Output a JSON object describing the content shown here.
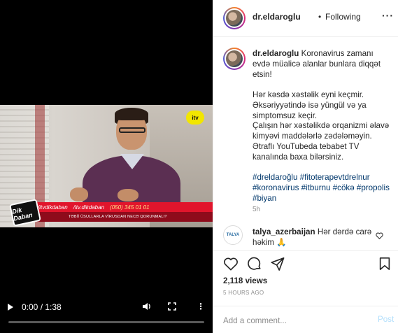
{
  "video": {
    "channel_logo": "itv",
    "show_badge": "Dik Daban",
    "lower_bar": {
      "facebook": "/itvdikdaban",
      "instagram": "/itv.dikdaban",
      "whatsapp": "(050) 345 01 01"
    },
    "lower_sub": "TƏBİİ ÜSULLARLA VİRUSDAN NECƏ QORUNMALI?",
    "time": "0:00 / 1:38",
    "progress_fraction": 0.0
  },
  "header": {
    "username": "dr.eldaroglu",
    "dot": "•",
    "follow_status": "Following",
    "menu_icon": "ellipsis-icon"
  },
  "caption": {
    "username": "dr.eldaroglu",
    "line1": "Koronavirus zamanı evdə müalicə alanlar bunlara diqqət etsin!",
    "para2": "Hər kəsdə xəstəlik eyni keçmir. Əksəriyyətində isə yüngül və ya simptomsuz keçir.",
    "para3": "Çalışın hər xəstəlikdə orqanizmi əlavə kimyəvi maddələrlə zədələməyin.",
    "para4": "Ətraflı YouTubeda tebabet TV kanalında baxa bilərsiniz.",
    "hashtags": "#dreldaroğlu #fitoterapevtdrelnur #koronavirus #itburnu #cökə #propolis #biyan",
    "time": "5h"
  },
  "comment": {
    "avatar_label": "TALYA",
    "username": "talya_azerbaijan",
    "text": "Hər dərdə carə həkim 🙏"
  },
  "actions": {
    "views": "2,118 views",
    "ago": "5 HOURS AGO",
    "comment_placeholder": "Add a comment...",
    "post_label": "Post"
  }
}
